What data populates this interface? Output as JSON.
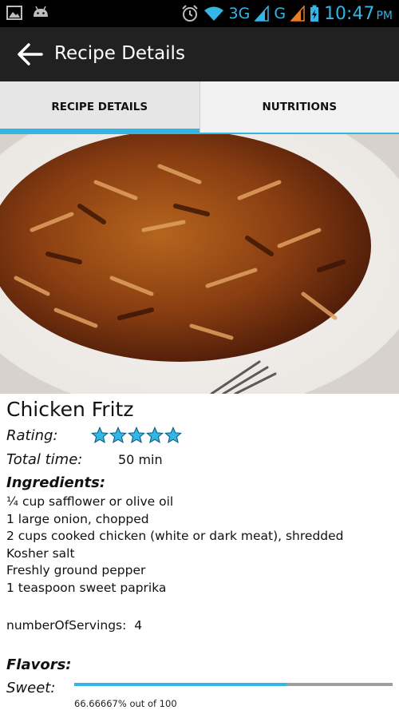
{
  "status_bar": {
    "network_3g": "3G",
    "network_g": "G",
    "time": "10:47",
    "ampm": "PM",
    "icons": [
      "gallery-icon",
      "android-icon",
      "alarm-icon",
      "wifi-icon",
      "signal-icon",
      "battery-charging-icon"
    ]
  },
  "action_bar": {
    "title": "Recipe Details",
    "back_icon": "back-arrow-icon"
  },
  "tabs": [
    {
      "label": "RECIPE DETAILS",
      "active": true
    },
    {
      "label": "NUTRITIONS",
      "active": false
    }
  ],
  "recipe": {
    "name": "Chicken Fritz",
    "rating_label": "Rating:",
    "rating": 5,
    "rating_max": 5,
    "total_time_label": "Total time:",
    "total_time": "50 min",
    "ingredients_label": "Ingredients:",
    "ingredients": [
      "¼ cup safflower or olive oil",
      "1 large onion, chopped",
      "2 cups cooked chicken (white or dark meat), shredded",
      "Kosher salt",
      "Freshly ground pepper",
      "1 teaspoon sweet paprika"
    ],
    "servings_text": "numberOfServings:  4",
    "flavors_label": "Flavors:",
    "flavors": [
      {
        "label": "Sweet:",
        "value": 66.66667,
        "max": 100,
        "value_text": "66.66667% out of 100"
      }
    ]
  },
  "colors": {
    "accent": "#33b5e5",
    "action_bar": "#212121",
    "status_bar": "#000000",
    "tab_bg": "#f2f2f2"
  }
}
